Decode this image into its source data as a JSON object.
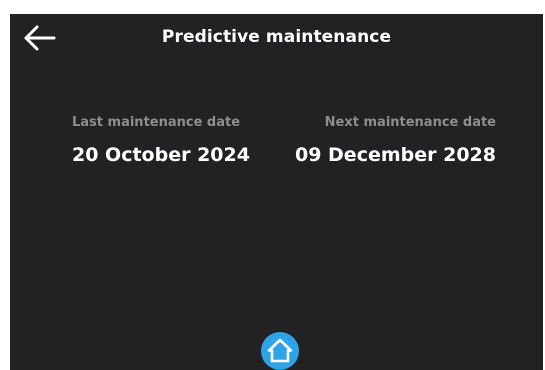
{
  "header": {
    "title": "Predictive maintenance",
    "back_icon": "arrow-left-icon"
  },
  "maintenance": {
    "last_label": "Last maintenance date",
    "last_value": "20 October 2024",
    "next_label": "Next maintenance date",
    "next_value": "09 December 2028"
  },
  "footer": {
    "home_icon": "home-icon"
  },
  "colors": {
    "background": "#222224",
    "label_gray": "#8e8e90",
    "text_white": "#ffffff",
    "accent_blue": "#2ea3e8"
  }
}
